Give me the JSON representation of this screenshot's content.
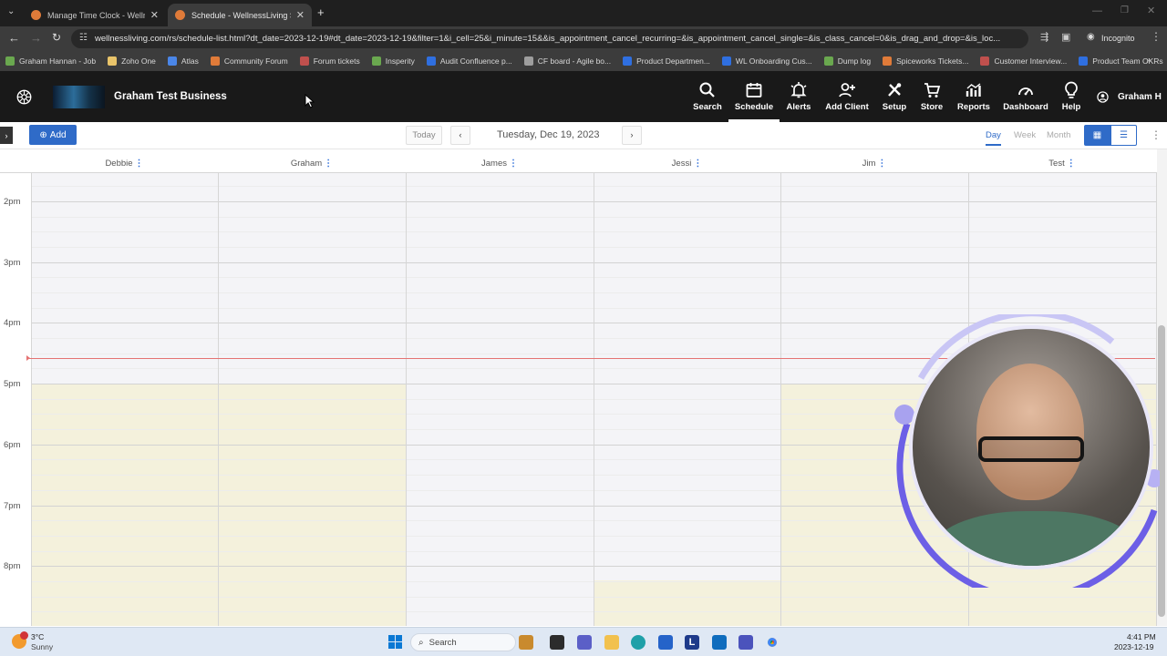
{
  "browser": {
    "tabs": [
      {
        "title": "Manage Time Clock - Wellness",
        "favicon_color": "#e07b39",
        "active": false
      },
      {
        "title": "Schedule - WellnessLiving Syste",
        "favicon_color": "#e07b39",
        "active": true
      }
    ],
    "url": "wellnessliving.com/rs/schedule-list.html?dt_date=2023-12-19#dt_date=2023-12-19&filter=1&i_cell=25&i_minute=15&&is_appointment_cancel_recurring=&is_appointment_cancel_single=&is_class_cancel=0&is_drag_and_drop=&is_loc...",
    "profile_label": "Incognito",
    "bookmarks": [
      {
        "label": "Graham Hannan - Job",
        "color": "#6aa84f"
      },
      {
        "label": "Zoho One",
        "color": "#e9c46a"
      },
      {
        "label": "Atlas",
        "color": "#4a86e8"
      },
      {
        "label": "Community Forum",
        "color": "#e07b39"
      },
      {
        "label": "Forum tickets",
        "color": "#c0504d"
      },
      {
        "label": "Insperity",
        "color": "#6aa84f"
      },
      {
        "label": "Audit Confluence p...",
        "color": "#2f6fe0"
      },
      {
        "label": "CF board - Agile bo...",
        "color": "#9e9e9e"
      },
      {
        "label": "Product Departmen...",
        "color": "#2f6fe0"
      },
      {
        "label": "WL Onboarding Cus...",
        "color": "#2f6fe0"
      },
      {
        "label": "Dump log",
        "color": "#6aa84f"
      },
      {
        "label": "Spiceworks Tickets...",
        "color": "#e07b39"
      },
      {
        "label": "Customer Interview...",
        "color": "#c0504d"
      },
      {
        "label": "Product Team OKRs",
        "color": "#2f6fe0"
      }
    ]
  },
  "app": {
    "business_name": "Graham Test Business",
    "user_name": "Graham H",
    "nav": [
      {
        "label": "Search",
        "icon": "search-icon"
      },
      {
        "label": "Schedule",
        "icon": "calendar-icon"
      },
      {
        "label": "Alerts",
        "icon": "bell-icon"
      },
      {
        "label": "Add Client",
        "icon": "add-person-icon"
      },
      {
        "label": "Setup",
        "icon": "wrench-icon"
      },
      {
        "label": "Store",
        "icon": "cart-icon"
      },
      {
        "label": "Reports",
        "icon": "chart-icon"
      },
      {
        "label": "Dashboard",
        "icon": "gauge-icon"
      },
      {
        "label": "Help",
        "icon": "lightbulb-icon"
      }
    ],
    "active_nav": "Schedule"
  },
  "schedule": {
    "add_label": "Add",
    "today_label": "Today",
    "date_label": "Tuesday, Dec 19, 2023",
    "views": [
      "Day",
      "Week",
      "Month"
    ],
    "active_view": "Day",
    "staff": [
      "Debbie",
      "Graham",
      "James",
      "Jessi",
      "Jim",
      "Test"
    ],
    "time_labels": [
      "2pm",
      "3pm",
      "4pm",
      "5pm",
      "6pm",
      "7pm",
      "8pm"
    ],
    "accent_color": "#2f6bc8",
    "available_color": "#f4f1dc",
    "current_time_line_color": "#e57373"
  },
  "taskbar": {
    "weather_temp": "3°C",
    "weather_desc": "Sunny",
    "search_label": "Search",
    "time": "4:41 PM",
    "date": "2023-12-19"
  }
}
